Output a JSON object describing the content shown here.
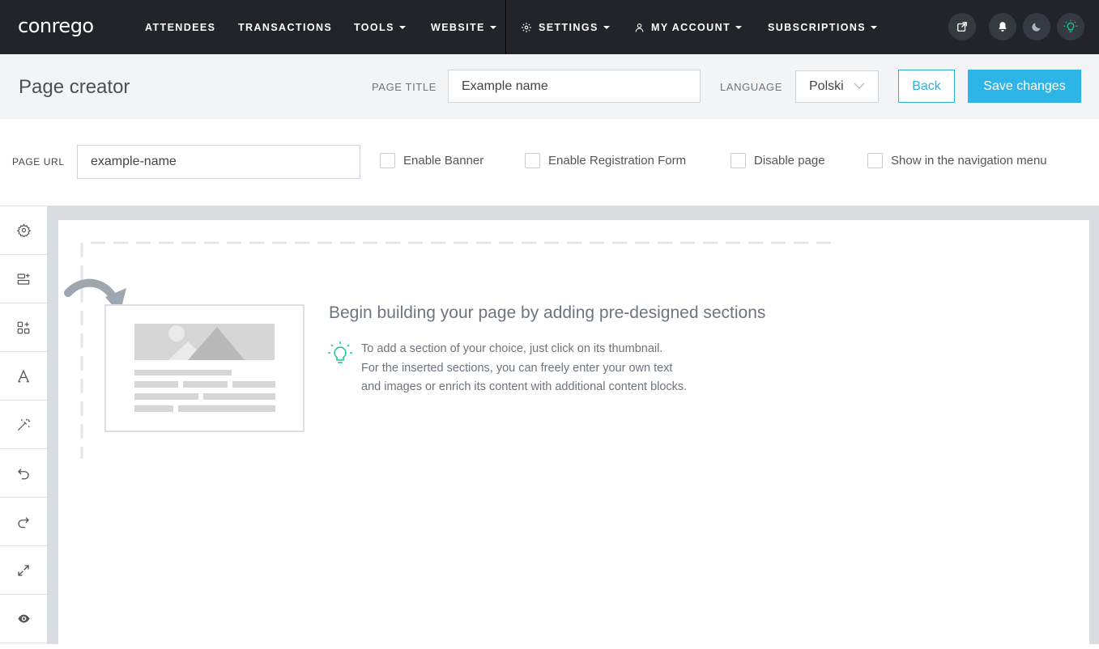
{
  "app": {
    "logo": "conrego"
  },
  "nav": {
    "items": [
      {
        "label": "ATTENDEES",
        "dropdown": false
      },
      {
        "label": "TRANSACTIONS",
        "dropdown": false
      },
      {
        "label": "TOOLS",
        "dropdown": true
      },
      {
        "label": "WEBSITE",
        "dropdown": true
      },
      {
        "label": "SETTINGS",
        "dropdown": true,
        "icon": "gear-icon"
      },
      {
        "label": "MY ACCOUNT",
        "dropdown": true,
        "icon": "user-icon"
      },
      {
        "label": "SUBSCRIPTIONS",
        "dropdown": true
      }
    ],
    "right_icons": [
      "external-link-icon",
      "bell-icon",
      "moon-icon",
      "sun-icon"
    ]
  },
  "header": {
    "title": "Page creator",
    "page_title_label": "PAGE TITLE",
    "page_title_value": "Example name",
    "language_label": "LANGUAGE",
    "language_value": "Polski",
    "back_label": "Back",
    "save_label": "Save changes"
  },
  "options": {
    "url_label": "PAGE URL",
    "url_value": "example-name",
    "checkboxes": [
      {
        "label": "Enable Banner",
        "checked": false
      },
      {
        "label": "Enable Registration Form",
        "checked": false
      },
      {
        "label": "Disable page",
        "checked": false
      },
      {
        "label": "Show in the navigation menu",
        "checked": false
      }
    ]
  },
  "toolbar": {
    "tools": [
      "settings-icon",
      "add-section-icon",
      "add-block-icon",
      "typography-icon",
      "magic-wand-icon",
      "undo-icon",
      "redo-icon",
      "expand-icon",
      "preview-icon"
    ]
  },
  "empty_state": {
    "title": "Begin building your page by adding pre-designed sections",
    "line1": "To add a section of your choice, just click on its thumbnail.",
    "line2": "For the inserted sections, you can freely enter your own text",
    "line3": "and images or enrich its content with additional content blocks."
  },
  "colors": {
    "navbar": "#212529",
    "accent": "#2eb5e8",
    "bulb": "#20c997"
  }
}
